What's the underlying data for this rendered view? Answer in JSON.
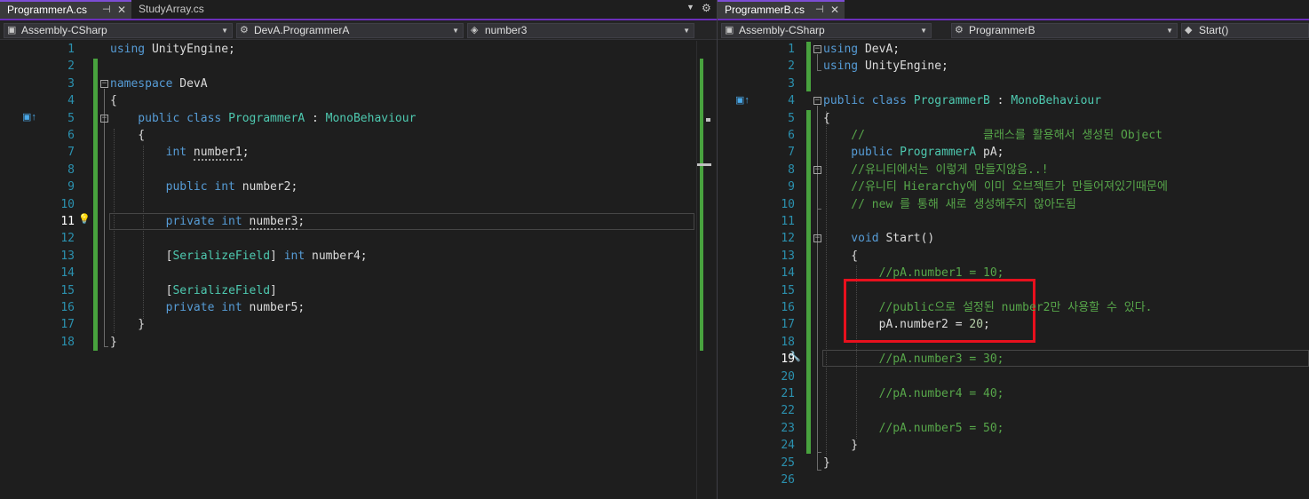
{
  "left": {
    "tabs": [
      {
        "label": "ProgrammerA.cs",
        "active": true
      },
      {
        "label": "StudyArray.cs",
        "active": false
      }
    ],
    "nav": {
      "project": "Assembly-CSharp",
      "type": "DevA.ProgrammerA",
      "member": "number3"
    },
    "current_line": 11
  },
  "right": {
    "tabs": [
      {
        "label": "ProgrammerB.cs",
        "active": true
      }
    ],
    "nav": {
      "project": "Assembly-CSharp",
      "type": "ProgrammerB",
      "member": "Start()"
    },
    "current_line": 19
  },
  "code_a": [
    {
      "n": "1",
      "tokens": [
        {
          "t": "using",
          "c": "kw"
        },
        {
          "t": " UnityEngine;",
          "c": "tx"
        }
      ]
    },
    {
      "n": "2",
      "tokens": []
    },
    {
      "n": "3",
      "tokens": [
        {
          "t": "namespace",
          "c": "kw"
        },
        {
          "t": " DevA",
          "c": "tx"
        }
      ]
    },
    {
      "n": "4",
      "tokens": [
        {
          "t": "{",
          "c": "tx"
        }
      ]
    },
    {
      "n": "5",
      "tokens": [
        {
          "t": "    public",
          "c": "kw"
        },
        {
          "t": " ",
          "c": "tx"
        },
        {
          "t": "class",
          "c": "kw"
        },
        {
          "t": " ",
          "c": "tx"
        },
        {
          "t": "ProgrammerA",
          "c": "ty"
        },
        {
          "t": " : ",
          "c": "tx"
        },
        {
          "t": "MonoBehaviour",
          "c": "ty"
        }
      ]
    },
    {
      "n": "6",
      "tokens": [
        {
          "t": "    {",
          "c": "tx"
        }
      ]
    },
    {
      "n": "7",
      "tokens": [
        {
          "t": "        int",
          "c": "kw"
        },
        {
          "t": " ",
          "c": "tx"
        },
        {
          "t": "number1",
          "c": "tx squig"
        },
        {
          "t": ";",
          "c": "tx"
        }
      ]
    },
    {
      "n": "8",
      "tokens": []
    },
    {
      "n": "9",
      "tokens": [
        {
          "t": "        public",
          "c": "kw"
        },
        {
          "t": " ",
          "c": "tx"
        },
        {
          "t": "int",
          "c": "kw"
        },
        {
          "t": " number2;",
          "c": "tx"
        }
      ]
    },
    {
      "n": "10",
      "tokens": []
    },
    {
      "n": "11",
      "tokens": [
        {
          "t": "        private",
          "c": "kw"
        },
        {
          "t": " ",
          "c": "tx"
        },
        {
          "t": "int",
          "c": "kw"
        },
        {
          "t": " ",
          "c": "tx"
        },
        {
          "t": "number3",
          "c": "tx squig"
        },
        {
          "t": ";",
          "c": "tx"
        }
      ]
    },
    {
      "n": "12",
      "tokens": []
    },
    {
      "n": "13",
      "tokens": [
        {
          "t": "        [",
          "c": "tx"
        },
        {
          "t": "SerializeField",
          "c": "ty"
        },
        {
          "t": "] ",
          "c": "tx"
        },
        {
          "t": "int",
          "c": "kw"
        },
        {
          "t": " number4;",
          "c": "tx"
        }
      ]
    },
    {
      "n": "14",
      "tokens": []
    },
    {
      "n": "15",
      "tokens": [
        {
          "t": "        [",
          "c": "tx"
        },
        {
          "t": "SerializeField",
          "c": "ty"
        },
        {
          "t": "]",
          "c": "tx"
        }
      ]
    },
    {
      "n": "16",
      "tokens": [
        {
          "t": "        private",
          "c": "kw"
        },
        {
          "t": " ",
          "c": "tx"
        },
        {
          "t": "int",
          "c": "kw"
        },
        {
          "t": " number5;",
          "c": "tx"
        }
      ]
    },
    {
      "n": "17",
      "tokens": [
        {
          "t": "    }",
          "c": "tx"
        }
      ]
    },
    {
      "n": "18",
      "tokens": [
        {
          "t": "}",
          "c": "tx"
        }
      ]
    }
  ],
  "code_b": [
    {
      "n": "1",
      "tokens": [
        {
          "t": "using",
          "c": "kw"
        },
        {
          "t": " DevA;",
          "c": "tx"
        }
      ]
    },
    {
      "n": "2",
      "tokens": [
        {
          "t": "using",
          "c": "kw"
        },
        {
          "t": " UnityEngine;",
          "c": "tx"
        }
      ]
    },
    {
      "n": "3",
      "tokens": []
    },
    {
      "n": "4",
      "tokens": [
        {
          "t": "public",
          "c": "kw"
        },
        {
          "t": " ",
          "c": "tx"
        },
        {
          "t": "class",
          "c": "kw"
        },
        {
          "t": " ",
          "c": "tx"
        },
        {
          "t": "ProgrammerB",
          "c": "ty"
        },
        {
          "t": " : ",
          "c": "tx"
        },
        {
          "t": "MonoBehaviour",
          "c": "ty"
        }
      ]
    },
    {
      "n": "5",
      "tokens": [
        {
          "t": "{",
          "c": "tx"
        }
      ]
    },
    {
      "n": "6",
      "tokens": [
        {
          "t": "    //                 클래스를 활용해서 생성된 Object",
          "c": "cm"
        }
      ]
    },
    {
      "n": "7",
      "tokens": [
        {
          "t": "    public",
          "c": "kw"
        },
        {
          "t": " ",
          "c": "tx"
        },
        {
          "t": "ProgrammerA",
          "c": "ty"
        },
        {
          "t": " pA;",
          "c": "tx"
        }
      ]
    },
    {
      "n": "8",
      "tokens": [
        {
          "t": "    //유니티에서는 이렇게 만들지않음..!",
          "c": "cm"
        }
      ]
    },
    {
      "n": "9",
      "tokens": [
        {
          "t": "    //유니티 Hierarchy에 이미 오브젝트가 만들어져있기때문에",
          "c": "cm"
        }
      ]
    },
    {
      "n": "10",
      "tokens": [
        {
          "t": "    // new 를 통해 새로 생성해주지 않아도됨",
          "c": "cm"
        }
      ]
    },
    {
      "n": "11",
      "tokens": []
    },
    {
      "n": "12",
      "tokens": [
        {
          "t": "    void",
          "c": "kw"
        },
        {
          "t": " Start()",
          "c": "tx"
        }
      ]
    },
    {
      "n": "13",
      "tokens": [
        {
          "t": "    {",
          "c": "tx"
        }
      ]
    },
    {
      "n": "14",
      "tokens": [
        {
          "t": "        //pA.number1 = 10;",
          "c": "cm"
        }
      ]
    },
    {
      "n": "15",
      "tokens": []
    },
    {
      "n": "16",
      "tokens": [
        {
          "t": "        //public으로 설정된 number2만 사용할 수 있다.",
          "c": "cm"
        }
      ]
    },
    {
      "n": "17",
      "tokens": [
        {
          "t": "        pA.number2 = ",
          "c": "tx"
        },
        {
          "t": "20",
          "c": "nm"
        },
        {
          "t": ";",
          "c": "tx"
        }
      ]
    },
    {
      "n": "18",
      "tokens": []
    },
    {
      "n": "19",
      "tokens": [
        {
          "t": "        //pA.number3 = 30;",
          "c": "cm"
        }
      ]
    },
    {
      "n": "20",
      "tokens": []
    },
    {
      "n": "21",
      "tokens": [
        {
          "t": "        //pA.number4 = 40;",
          "c": "cm"
        }
      ]
    },
    {
      "n": "22",
      "tokens": []
    },
    {
      "n": "23",
      "tokens": [
        {
          "t": "        //pA.number5 = 50;",
          "c": "cm"
        }
      ]
    },
    {
      "n": "24",
      "tokens": [
        {
          "t": "    }",
          "c": "tx"
        }
      ]
    },
    {
      "n": "25",
      "tokens": [
        {
          "t": "}",
          "c": "tx"
        }
      ]
    },
    {
      "n": "26",
      "tokens": []
    }
  ]
}
